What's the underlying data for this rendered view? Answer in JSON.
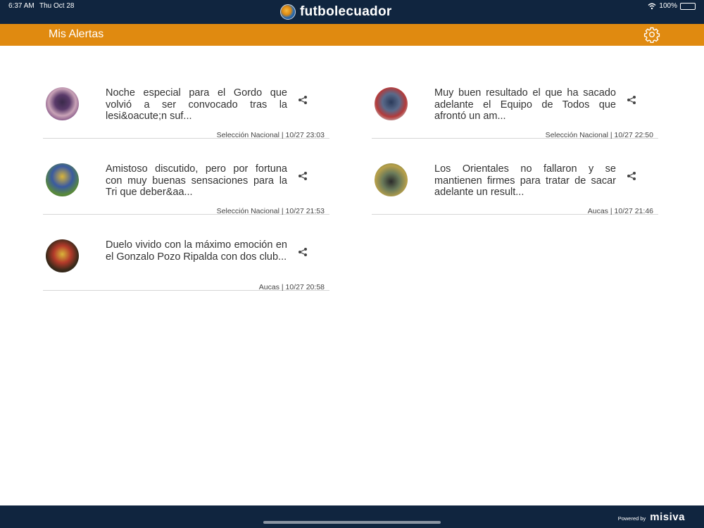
{
  "status_bar": {
    "time": "6:37 AM",
    "date": "Thu Oct 28",
    "battery": "100%",
    "battery_level": 1.0
  },
  "app": {
    "logo_text": "futbolecuador"
  },
  "header": {
    "title": "Mis Alertas",
    "settings_icon": "gear-icon"
  },
  "alerts": [
    {
      "headline": "Noche especial para el Gordo que volvió a ser convocado tras la lesi&oacute;n suf...",
      "category": "Selección Nacional",
      "datetime": "10/27 23:03",
      "meta": "Selección Nacional | 10/27 23:03"
    },
    {
      "headline": "Muy buen resultado el que ha sacado adelante el Equipo de Todos que afrontó un am...",
      "category": "Selección Nacional",
      "datetime": "10/27 22:50",
      "meta": "Selección Nacional | 10/27 22:50"
    },
    {
      "headline": "Amistoso discutido, pero por fortuna con muy buenas sensaciones para la Tri que deber&aa...",
      "category": "Selección Nacional",
      "datetime": "10/27 21:53",
      "meta": "Selección Nacional | 10/27 21:53"
    },
    {
      "headline": "Los Orientales no fallaron y se mantienen firmes para tratar de sacar adelante un result...",
      "category": "Aucas",
      "datetime": "10/27 21:46",
      "meta": "Aucas | 10/27 21:46"
    },
    {
      "headline": "Duelo vivido con la máximo emoción en el Gonzalo Pozo Ripalda con dos club...",
      "category": "Aucas",
      "datetime": "10/27 20:58",
      "meta": "Aucas | 10/27 20:58"
    }
  ],
  "footer": {
    "powered_by": "Powered by",
    "brand": "misiva"
  },
  "colors": {
    "navy": "#10253f",
    "accent": "#e08a10"
  }
}
